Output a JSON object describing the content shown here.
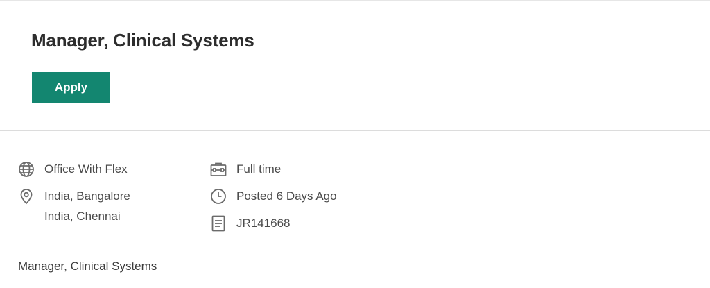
{
  "job": {
    "title": "Manager, Clinical Systems",
    "apply_label": "Apply"
  },
  "meta": {
    "work_mode": "Office With Flex",
    "locations": [
      "India, Bangalore",
      "India, Chennai"
    ],
    "employment_type": "Full time",
    "posted": "Posted 6 Days Ago",
    "requisition_id": "JR141668"
  },
  "description": {
    "first_line": "Manager, Clinical Systems"
  },
  "colors": {
    "accent": "#138670",
    "icon": "#6b6b6b"
  }
}
